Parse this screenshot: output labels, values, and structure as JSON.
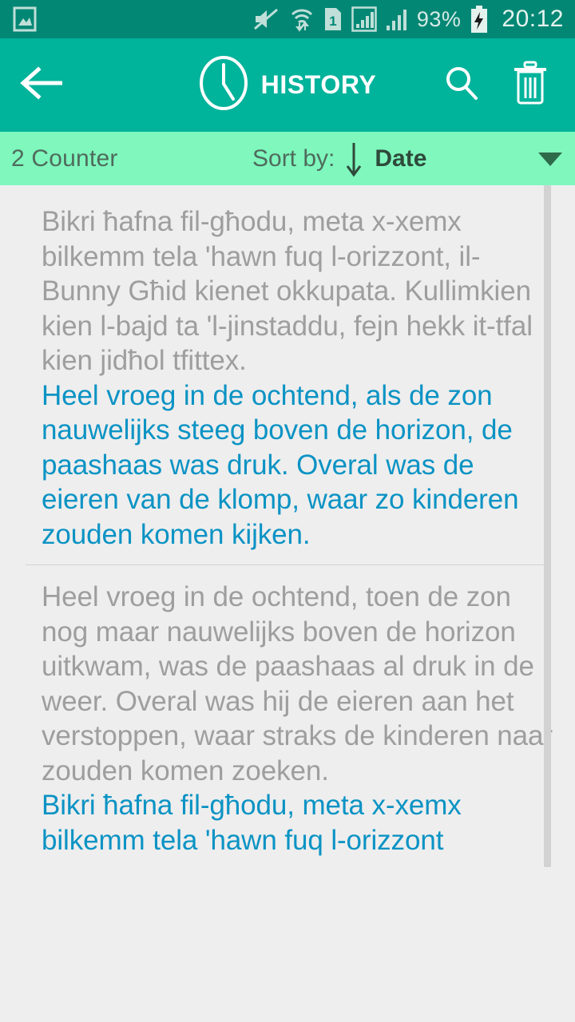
{
  "status_bar": {
    "notification_icon": "gallery-image-icon",
    "icons": [
      "mute-icon",
      "wifi-transfer-icon",
      "sim-1-icon",
      "signal-boxed-icon",
      "signal-bars-icon"
    ],
    "battery_percent": "93%",
    "battery_state_icon": "battery-charging-icon",
    "time": "20:12",
    "background_color": "#038775"
  },
  "app_bar": {
    "back_icon": "back-arrow-icon",
    "title_icon": "clock-icon",
    "title": "HISTORY",
    "search_icon": "search-icon",
    "delete_icon": "trash-icon",
    "background_color": "#00b39b"
  },
  "sort_bar": {
    "counter": "2 Counter",
    "sort_label": "Sort by:",
    "direction_icon": "arrow-down-icon",
    "sort_value": "Date",
    "dropdown_icon": "caret-down-icon",
    "background_color": "#7ff7bd"
  },
  "colors": {
    "source_text": "#9e9e9e",
    "translation_text": "#0b93c4",
    "content_background": "#eeeeee",
    "divider": "#d2d2d2"
  },
  "history": {
    "entries": [
      {
        "source": "Bikri ħafna fil-għodu, meta x-xemx bilkemm tela 'hawn fuq l-orizzont, il-Bunny Għid kienet okkupata. Kullimkien kien l-bajd ta 'l-jinstaddu, fejn hekk it-tfal kien jidħol tfittex.",
        "translation": "Heel vroeg in de ochtend, als de zon nauwelijks steeg boven de horizon, de paashaas was druk. Overal was de eieren van de klomp, waar zo kinderen zouden komen kijken."
      },
      {
        "source": "Heel vroeg in de ochtend, toen de zon nog maar nauwelijks boven de horizon uitkwam, was de paashaas al druk in de weer. Overal was hij de eieren aan het verstoppen, waar straks de kinderen naar zouden komen zoeken.",
        "translation": "Bikri ħafna fil-għodu, meta x-xemx bilkemm tela 'hawn fuq l-orizzont"
      }
    ]
  }
}
